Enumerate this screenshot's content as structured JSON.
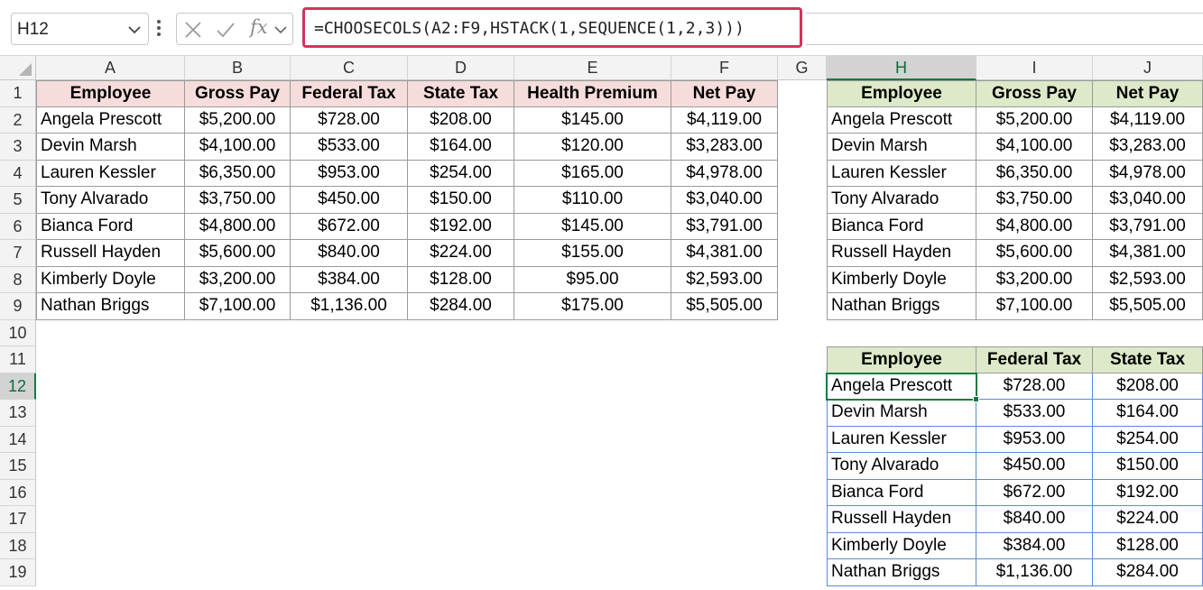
{
  "formula_bar": {
    "name_box": "H12",
    "fx_label": "fx",
    "formula": "=CHOOSECOLS(A2:F9,HSTACK(1,SEQUENCE(1,2,3)))"
  },
  "columns": [
    "A",
    "B",
    "C",
    "D",
    "E",
    "F",
    "G",
    "H",
    "I",
    "J"
  ],
  "rows": [
    "1",
    "2",
    "3",
    "4",
    "5",
    "6",
    "7",
    "8",
    "9",
    "10",
    "11",
    "12",
    "13",
    "14",
    "15",
    "16",
    "17",
    "18",
    "19"
  ],
  "selected": {
    "column": "H",
    "row": "12"
  },
  "source_table": {
    "headers": [
      "Employee",
      "Gross Pay",
      "Federal Tax",
      "State Tax",
      "Health Premium",
      "Net Pay"
    ],
    "rows": [
      [
        "Angela Prescott",
        "$5,200.00",
        "$728.00",
        "$208.00",
        "$145.00",
        "$4,119.00"
      ],
      [
        "Devin Marsh",
        "$4,100.00",
        "$533.00",
        "$164.00",
        "$120.00",
        "$3,283.00"
      ],
      [
        "Lauren Kessler",
        "$6,350.00",
        "$953.00",
        "$254.00",
        "$165.00",
        "$4,978.00"
      ],
      [
        "Tony Alvarado",
        "$3,750.00",
        "$450.00",
        "$150.00",
        "$110.00",
        "$3,040.00"
      ],
      [
        "Bianca Ford",
        "$4,800.00",
        "$672.00",
        "$192.00",
        "$145.00",
        "$3,791.00"
      ],
      [
        "Russell Hayden",
        "$5,600.00",
        "$840.00",
        "$224.00",
        "$155.00",
        "$4,381.00"
      ],
      [
        "Kimberly Doyle",
        "$3,200.00",
        "$384.00",
        "$128.00",
        "$95.00",
        "$2,593.00"
      ],
      [
        "Nathan Briggs",
        "$7,100.00",
        "$1,136.00",
        "$284.00",
        "$175.00",
        "$5,505.00"
      ]
    ]
  },
  "result_table_1": {
    "headers": [
      "Employee",
      "Gross Pay",
      "Net Pay"
    ],
    "rows": [
      [
        "Angela Prescott",
        "$5,200.00",
        "$4,119.00"
      ],
      [
        "Devin Marsh",
        "$4,100.00",
        "$3,283.00"
      ],
      [
        "Lauren Kessler",
        "$6,350.00",
        "$4,978.00"
      ],
      [
        "Tony Alvarado",
        "$3,750.00",
        "$3,040.00"
      ],
      [
        "Bianca Ford",
        "$4,800.00",
        "$3,791.00"
      ],
      [
        "Russell Hayden",
        "$5,600.00",
        "$4,381.00"
      ],
      [
        "Kimberly Doyle",
        "$3,200.00",
        "$2,593.00"
      ],
      [
        "Nathan Briggs",
        "$7,100.00",
        "$5,505.00"
      ]
    ]
  },
  "result_table_2": {
    "headers": [
      "Employee",
      "Federal Tax",
      "State Tax"
    ],
    "rows": [
      [
        "Angela Prescott",
        "$728.00",
        "$208.00"
      ],
      [
        "Devin Marsh",
        "$533.00",
        "$164.00"
      ],
      [
        "Lauren Kessler",
        "$953.00",
        "$254.00"
      ],
      [
        "Tony Alvarado",
        "$450.00",
        "$150.00"
      ],
      [
        "Bianca Ford",
        "$672.00",
        "$192.00"
      ],
      [
        "Russell Hayden",
        "$840.00",
        "$224.00"
      ],
      [
        "Kimberly Doyle",
        "$384.00",
        "$128.00"
      ],
      [
        "Nathan Briggs",
        "$1,136.00",
        "$284.00"
      ]
    ]
  },
  "colors": {
    "source_header_fill": "#f7dcdc",
    "result_header_fill": "#dde9c8",
    "formula_highlight": "#d6325b",
    "selection": "#117b43",
    "spill_border": "#5b8ad6"
  },
  "icons": [
    "chevron-down-icon",
    "more-dots-icon",
    "cancel-x-icon",
    "confirm-check-icon",
    "fx-icon",
    "select-all-icon",
    "fill-handle"
  ]
}
